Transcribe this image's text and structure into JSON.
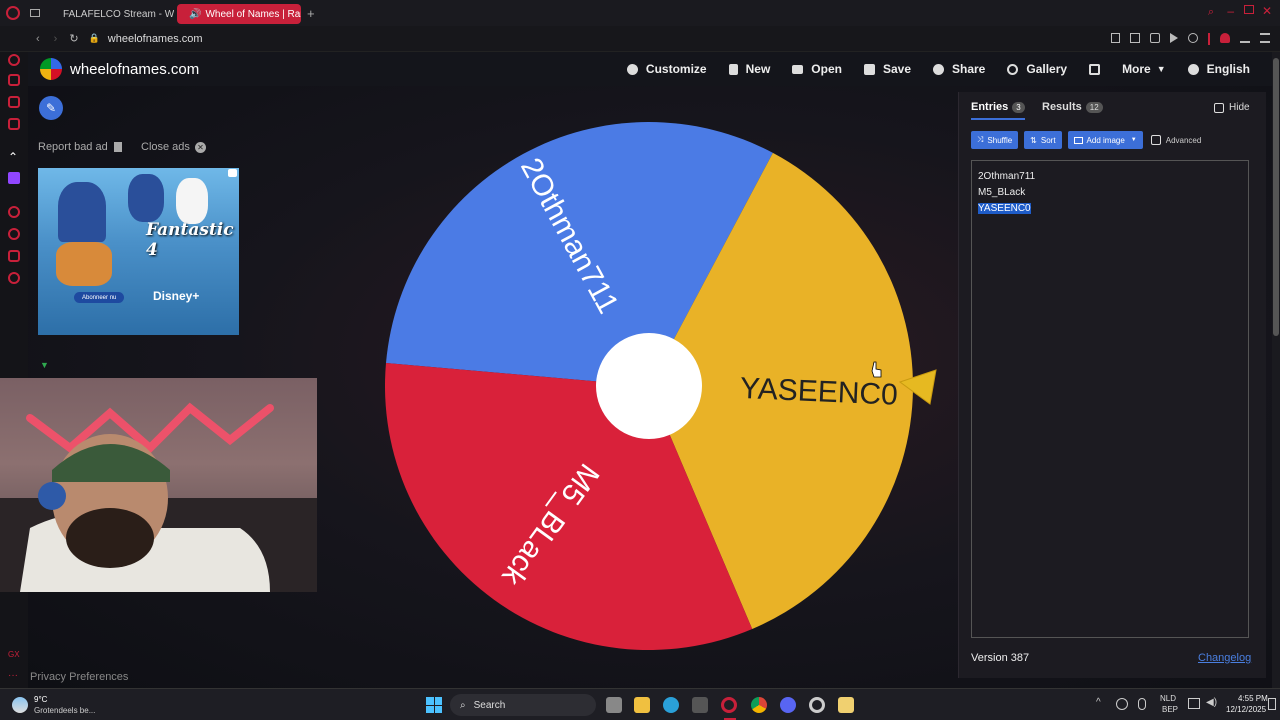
{
  "browser": {
    "tabs": [
      {
        "label": "FALAFELCO Stream - Wat",
        "active": false
      },
      {
        "label": "Wheel of Names | Ran",
        "active": true
      }
    ],
    "url": "wheelofnames.com"
  },
  "app": {
    "brand": "wheelofnames.com",
    "menu": [
      {
        "label": "Customize",
        "icon": "palette-icon"
      },
      {
        "label": "New",
        "icon": "file-icon"
      },
      {
        "label": "Open",
        "icon": "folder-icon"
      },
      {
        "label": "Save",
        "icon": "save-icon"
      },
      {
        "label": "Share",
        "icon": "share-icon"
      },
      {
        "label": "Gallery",
        "icon": "search-icon"
      },
      {
        "label": "",
        "icon": "fullscreen-icon"
      },
      {
        "label": "More",
        "icon": "chevron-down-icon"
      },
      {
        "label": "English",
        "icon": "globe-icon"
      }
    ]
  },
  "left": {
    "report_label": "Report bad ad",
    "close_ads_label": "Close ads",
    "ad_title": "Fantastic 4",
    "ad_brand": "Disney+",
    "ad_button": "Abonneer nu",
    "privacy_label": "Privacy Preferences"
  },
  "wheel": {
    "segments": [
      {
        "name": "2Othman711",
        "color": "#4b7be5"
      },
      {
        "name": "YASEENC0",
        "color": "#e9b227"
      },
      {
        "name": "M5_BLack",
        "color": "#d9213a"
      }
    ]
  },
  "panel": {
    "tabs": [
      {
        "label": "Entries",
        "count": "3",
        "active": true
      },
      {
        "label": "Results",
        "count": "12",
        "active": false
      }
    ],
    "hide_label": "Hide",
    "buttons": {
      "shuffle": "Shuffle",
      "sort": "Sort",
      "add_image": "Add image",
      "advanced": "Advanced"
    },
    "entries": [
      "2Othman711",
      "M5_BLack",
      "YASEENC0"
    ],
    "version": "Version 387",
    "changelog": "Changelog"
  },
  "taskbar": {
    "weather_temp": "9°C",
    "weather_desc": "Grotendeels be...",
    "search_label": "Search",
    "lang_top": "NLD",
    "lang_bottom": "BEP",
    "time": "4:55 PM",
    "date": "12/12/2025"
  }
}
